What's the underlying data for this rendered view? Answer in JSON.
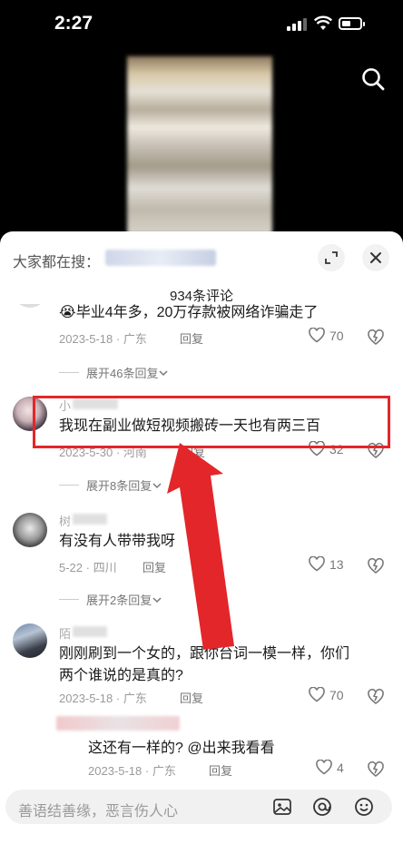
{
  "status_bar": {
    "time": "2:27"
  },
  "sheet": {
    "search_label": "大家都在搜：",
    "comment_count": "934条评论"
  },
  "comments": [
    {
      "text": "😭毕业4年多，20万存款被网络诈骗走了",
      "date": "2023-5-18 · 广东",
      "reply": "回复",
      "likes": "70",
      "expand": "展开46条回复"
    },
    {
      "name": "小",
      "text": "我现在副业做短视频搬砖一天也有两三百",
      "date": "2023-5-30 · 河南",
      "reply": "回复",
      "likes": "32",
      "expand": "展开8条回复"
    },
    {
      "name": "树",
      "text": "有没有人带带我呀",
      "date": "5-22 · 四川",
      "reply": "回复",
      "likes": "13",
      "expand": "展开2条回复"
    },
    {
      "name": "陌",
      "text_line1": "刚刚刷到一个女的，跟你台词一模一样，你们",
      "text_line2": "两个谁说的是真的?",
      "date": "2023-5-18 · 广东",
      "reply": "回复",
      "likes": "70"
    },
    {
      "text": "这还有一样的? @出来我看看",
      "date": "2023-5-18 · 广东",
      "reply": "回复",
      "likes": "4"
    }
  ],
  "input": {
    "placeholder": "善语结善缘，恶言伤人心"
  },
  "colors": {
    "highlight_red": "#e3262a",
    "sheet_bg": "#ffffff"
  },
  "icons": [
    "search-icon",
    "expand-icon",
    "close-icon",
    "heart-icon",
    "dislike-icon",
    "chevron-down-icon",
    "image-icon",
    "at-icon",
    "emoji-icon"
  ]
}
